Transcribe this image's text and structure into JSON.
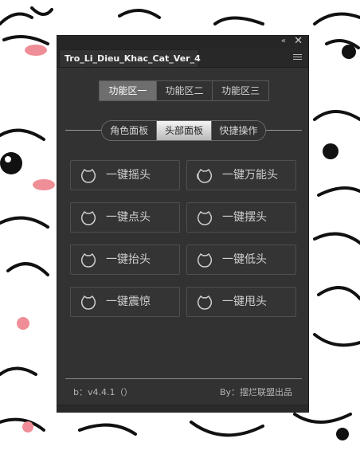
{
  "panel": {
    "tab_title": "Tro_Li_Dieu_Khac_Cat_Ver_4",
    "collapse_glyph": "«",
    "close_glyph": "✕"
  },
  "function_tabs": [
    {
      "label": "功能区一",
      "active": true
    },
    {
      "label": "功能区二",
      "active": false
    },
    {
      "label": "功能区三",
      "active": false
    }
  ],
  "panel_tabs": [
    {
      "label": "角色面板",
      "active": false
    },
    {
      "label": "头部面板",
      "active": true
    },
    {
      "label": "快捷操作",
      "active": false
    }
  ],
  "actions": [
    {
      "label": "一键摇头",
      "icon": "cat-head-icon"
    },
    {
      "label": "一键万能头",
      "icon": "cat-head-multi-icon"
    },
    {
      "label": "一键点头",
      "icon": "cat-head-icon"
    },
    {
      "label": "一键摆头",
      "icon": "cat-head-icon"
    },
    {
      "label": "一键抬头",
      "icon": "cat-head-icon"
    },
    {
      "label": "一键低头",
      "icon": "cat-head-icon"
    },
    {
      "label": "一键震惊",
      "icon": "cat-head-icon"
    },
    {
      "label": "一键甩头",
      "icon": "cat-head-icon"
    }
  ],
  "footer": {
    "version": "b：v4.4.1（）",
    "credit": "By：摆烂联盟出品"
  },
  "colors": {
    "panel_bg": "#323232",
    "titlebar_bg": "#262626",
    "active_tab": "#6e6e6e",
    "text": "#cfcfcf"
  }
}
